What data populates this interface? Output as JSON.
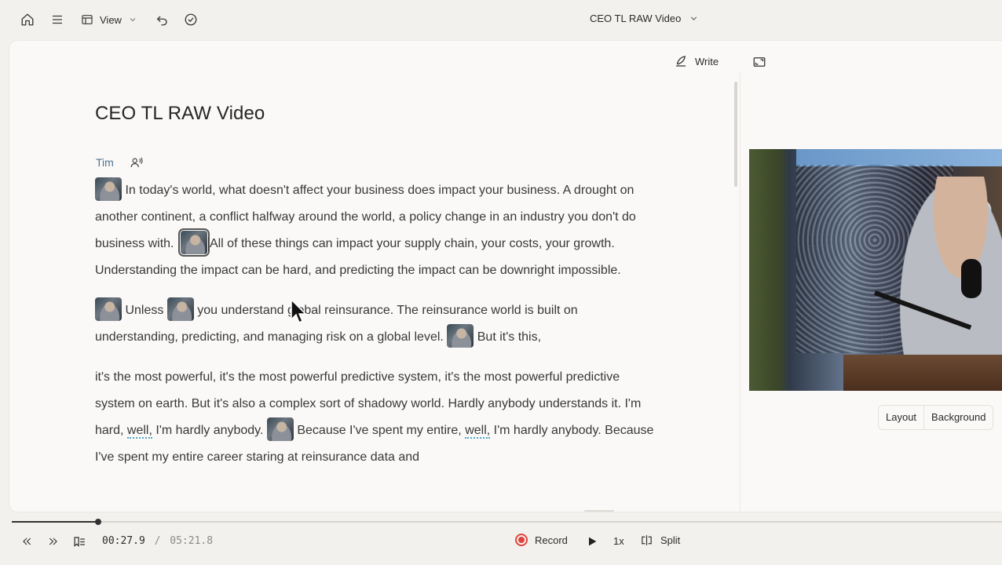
{
  "topbar": {
    "view_label": "View",
    "document_title": "CEO TL RAW Video"
  },
  "editor": {
    "write_label": "Write",
    "doc_title": "CEO TL RAW Video",
    "speaker": "Tim",
    "paragraphs": {
      "p1": {
        "s1": "In today's world, what doesn't affect your business does impact your business. A drought on another continent, a conflict halfway around the world, a policy change in an industry you don't do business with.",
        "s2": "All of these things can impact your supply chain, your costs, your growth. Understanding the impact can be hard, and predicting the impact can be downright impossible."
      },
      "p2": {
        "s1": "Unless",
        "s2": "you understand global reinsurance. The reinsurance world is built on understanding, predicting, and managing risk on a global level.",
        "s3": "But it's this,"
      },
      "p3": {
        "s1": "it's the most powerful, it's the most powerful predictive system, it's the most powerful predictive system on earth. But it's also a complex sort of shadowy world. Hardly anybody understands it. I'm hard,",
        "w1": "well,",
        "s2": "I'm hardly anybody.",
        "s3": "Because I've spent my entire,",
        "w2": "well,",
        "s4": "I'm hardly anybody. Because I've spent my entire career staring at reinsurance data and"
      }
    }
  },
  "video_panel": {
    "tabs": [
      "Layout",
      "Background"
    ]
  },
  "player": {
    "current_time": "00:27.9",
    "separator": "/",
    "total_time": "05:21.8",
    "progress_fraction": 0.087,
    "record_label": "Record",
    "speed_label": "1x",
    "split_label": "Split",
    "record_color": "#e0433c"
  }
}
